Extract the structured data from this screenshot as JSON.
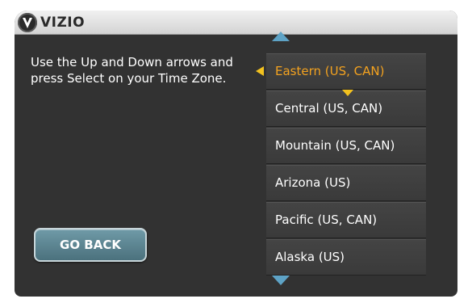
{
  "header": {
    "brand": "VIZIO",
    "logo_icon": "vizio-v-logo-icon"
  },
  "main": {
    "instructions": "Use the Up and Down arrows and press Select on your Time Zone.",
    "go_back_label": "GO BACK"
  },
  "timezone_list": {
    "selected_index": 0,
    "items": [
      {
        "label": "Eastern (US, CAN)"
      },
      {
        "label": "Central (US, CAN)"
      },
      {
        "label": "Mountain (US, CAN)"
      },
      {
        "label": "Arizona (US)"
      },
      {
        "label": "Pacific (US, CAN)"
      },
      {
        "label": "Alaska (US)"
      }
    ],
    "scroll_up_icon": "triangle-up-icon",
    "scroll_down_icon": "triangle-down-icon",
    "selection_pointer_icon": "triangle-left-icon",
    "focus_pointer_icon": "triangle-down-icon"
  },
  "colors": {
    "background": "#323232",
    "titlebar": "#e2e2e2",
    "selected_text": "#f3a21f",
    "list_item": "#404040",
    "arrows": "#5ea3c6",
    "button": "#5b8793"
  }
}
